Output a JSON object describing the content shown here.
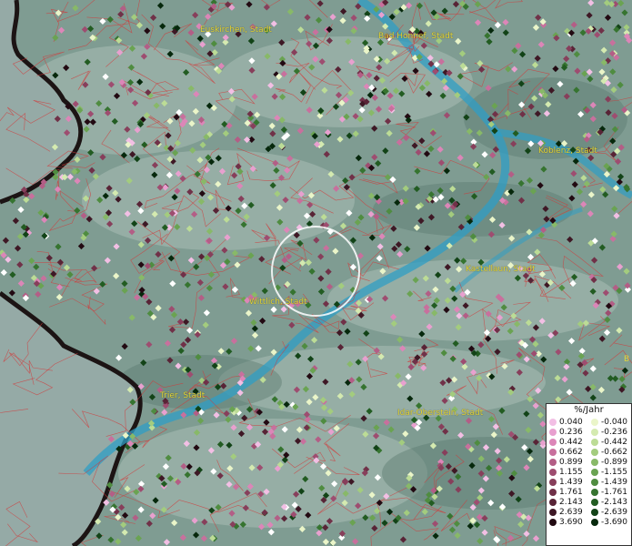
{
  "map": {
    "cities": [
      {
        "name": "Euskirchen, Stadt"
      },
      {
        "name": "Bad Honnef, Stadt"
      },
      {
        "name": "Koblenz, Stadt"
      },
      {
        "name": "Kastellaun, Stadt"
      },
      {
        "name": "Wittlich, Stadt"
      },
      {
        "name": "Trier, Stadt"
      },
      {
        "name": "Idar-Oberstein, Stadt"
      }
    ],
    "edge_label": "B"
  },
  "legend": {
    "title": "%/Jahr",
    "positive": [
      {
        "value": "0.040",
        "color": "#f2bfe4"
      },
      {
        "value": "0.236",
        "color": "#e8a0cf"
      },
      {
        "value": "0.442",
        "color": "#dc86b8"
      },
      {
        "value": "0.662",
        "color": "#c8709d"
      },
      {
        "value": "0.899",
        "color": "#b35e86"
      },
      {
        "value": "1.155",
        "color": "#9e4d70"
      },
      {
        "value": "1.439",
        "color": "#873f5b"
      },
      {
        "value": "1.761",
        "color": "#703148"
      },
      {
        "value": "2.143",
        "color": "#582436"
      },
      {
        "value": "2.639",
        "color": "#3e1825"
      },
      {
        "value": "3.690",
        "color": "#220a12"
      }
    ],
    "negative": [
      {
        "value": "-0.040",
        "color": "#eaf5c9"
      },
      {
        "value": "-0.236",
        "color": "#d4eab0"
      },
      {
        "value": "-0.442",
        "color": "#bcdc96"
      },
      {
        "value": "-0.662",
        "color": "#a3cc7e"
      },
      {
        "value": "-0.899",
        "color": "#88b968"
      },
      {
        "value": "-1.155",
        "color": "#6aa352"
      },
      {
        "value": "-1.439",
        "color": "#4f8c40"
      },
      {
        "value": "-1.761",
        "color": "#367430"
      },
      {
        "value": "-2.143",
        "color": "#225c22"
      },
      {
        "value": "-2.639",
        "color": "#124317"
      },
      {
        "value": "-3.690",
        "color": "#06280c"
      }
    ]
  },
  "colors": {
    "terrain": "#7f9c92",
    "river": "#2f9ec4",
    "boundaries": "#d23a3a",
    "border": "#1c1414",
    "city_label": "#e2d63a",
    "no_change": "#ffffff"
  }
}
